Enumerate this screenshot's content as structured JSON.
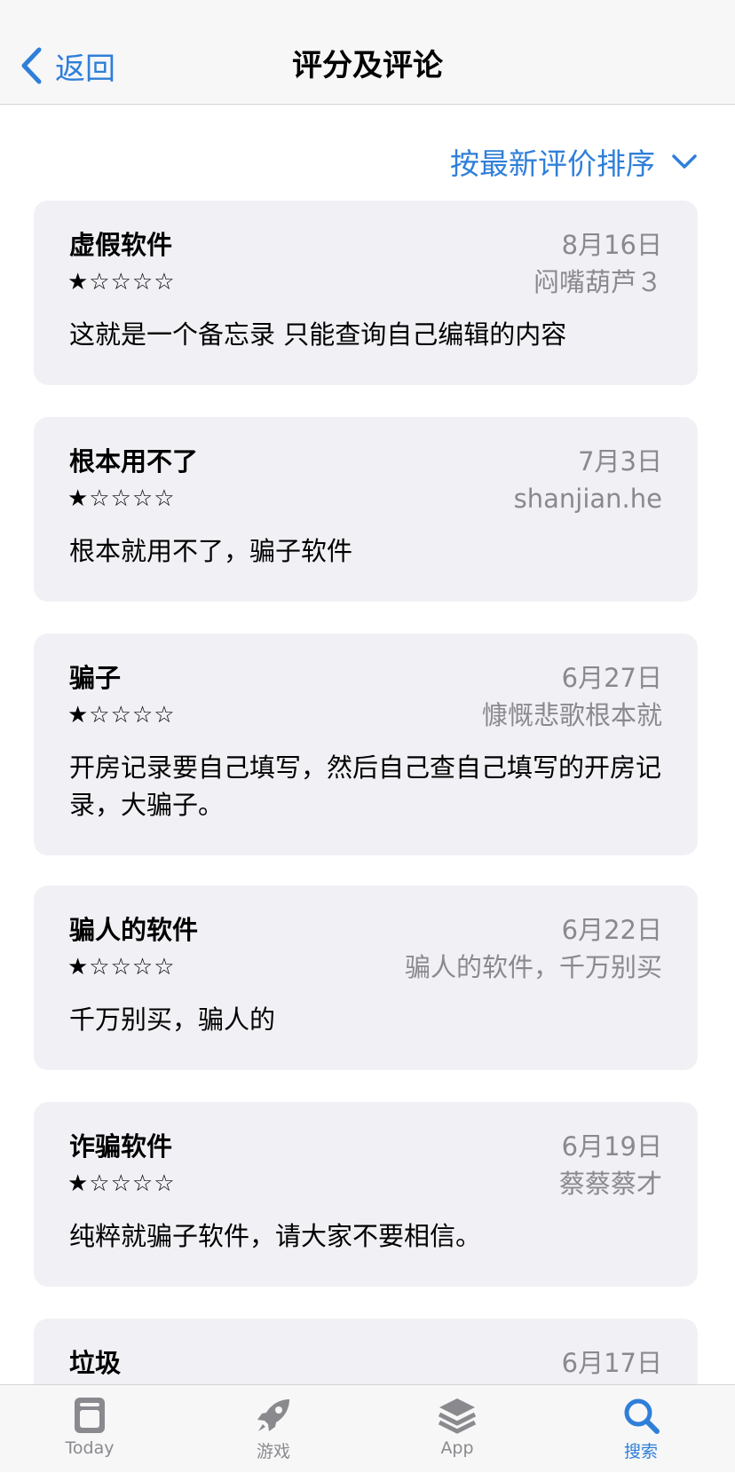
{
  "nav": {
    "back_label": "返回",
    "title": "评分及评论"
  },
  "sort": {
    "label": "按最新评价排序"
  },
  "reviews": [
    {
      "title": "虚假软件",
      "date": "8月16日",
      "author": "闷嘴葫芦３",
      "rating": 1,
      "stars": "★☆☆☆☆",
      "body": "这就是一个备忘录 只能查询自己编辑的内容"
    },
    {
      "title": "根本用不了",
      "date": "7月3日",
      "author": "shanjian.he",
      "rating": 1,
      "stars": "★☆☆☆☆",
      "body": "根本就用不了，骗子软件"
    },
    {
      "title": "骗子",
      "date": "6月27日",
      "author": "慷慨悲歌根本就",
      "rating": 1,
      "stars": "★☆☆☆☆",
      "body": "开房记录要自己填写，然后自己查自己填写的开房记录，大骗子。"
    },
    {
      "title": "骗人的软件",
      "date": "6月22日",
      "author": "骗人的软件，千万别买",
      "rating": 1,
      "stars": "★☆☆☆☆",
      "body": "千万别买，骗人的"
    },
    {
      "title": "诈骗软件",
      "date": "6月19日",
      "author": "蔡蔡蔡才",
      "rating": 1,
      "stars": "★☆☆☆☆",
      "body": "纯粹就骗子软件，请大家不要相信。"
    },
    {
      "title": "垃圾",
      "date": "6月17日"
    }
  ],
  "tabbar": {
    "items": [
      {
        "label": "Today",
        "icon": "today-icon",
        "active": false
      },
      {
        "label": "游戏",
        "icon": "rocket-icon",
        "active": false
      },
      {
        "label": "App",
        "icon": "layers-icon",
        "active": false
      },
      {
        "label": "搜索",
        "icon": "search-icon",
        "active": true
      }
    ]
  },
  "colors": {
    "accent": "#2f7fd9",
    "star": "#f5a623",
    "card_bg": "#f1f1f5",
    "secondary_text": "#8a8a8e"
  }
}
